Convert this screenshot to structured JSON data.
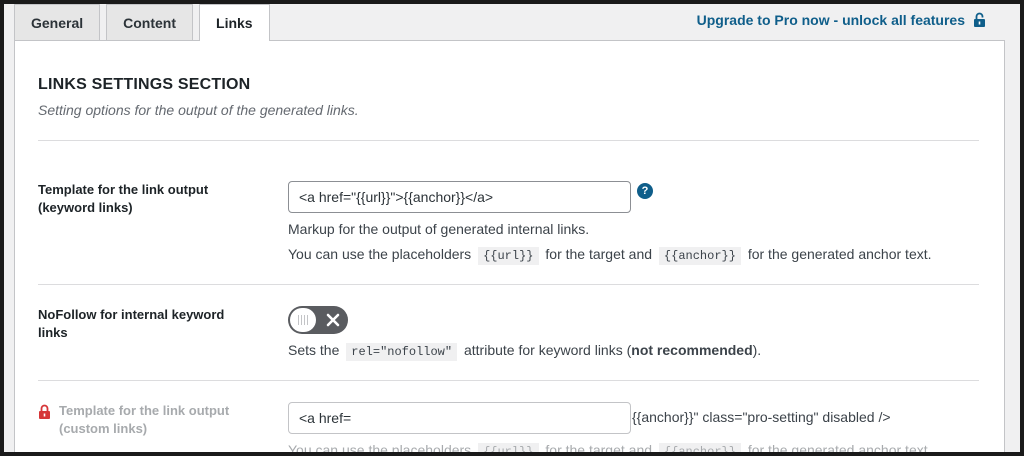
{
  "tabs": [
    {
      "label": "General",
      "active": false
    },
    {
      "label": "Content",
      "active": false
    },
    {
      "label": "Links",
      "active": true
    }
  ],
  "upgrade": {
    "label": "Upgrade to Pro now - unlock all features",
    "icon": "lock-open-icon",
    "color": "#0f5e8a"
  },
  "section": {
    "title": "LINKS SETTINGS SECTION",
    "description": "Setting options for the output of the generated links."
  },
  "template_keyword": {
    "label_line1": "Template for the link output",
    "label_line2": "(keyword links)",
    "value": "<a href=\"{{url}}\">{{anchor}}</a>",
    "help": "?",
    "desc1": "Markup for the output of generated internal links.",
    "desc2_pre": "You can use the placeholders",
    "placeholder_url": "{{url}}",
    "desc2_mid": "for the target and",
    "placeholder_anchor": "{{anchor}}",
    "desc2_post": "for the generated anchor text."
  },
  "nofollow": {
    "label_line1": "NoFollow for internal keyword",
    "label_line2": "links",
    "enabled": false,
    "desc_pre": "Sets the",
    "code": "rel=\"nofollow\"",
    "desc_mid": "attribute for keyword links (",
    "desc_bold": "not recommended",
    "desc_post": ")."
  },
  "template_custom": {
    "label_line1": "Template for the link output",
    "label_line2": "(custom links)",
    "value": "<a href=",
    "tail": "{{anchor}}\" class=\"pro-setting\" disabled />",
    "desc_pre": "You can use the placeholders",
    "placeholder_url": "{{url}}",
    "desc_mid": "for the target and",
    "placeholder_anchor": "{{anchor}}",
    "desc_post": "for the generated anchor text.",
    "lock_icon": "lock-icon",
    "lock_color": "#d63638"
  }
}
